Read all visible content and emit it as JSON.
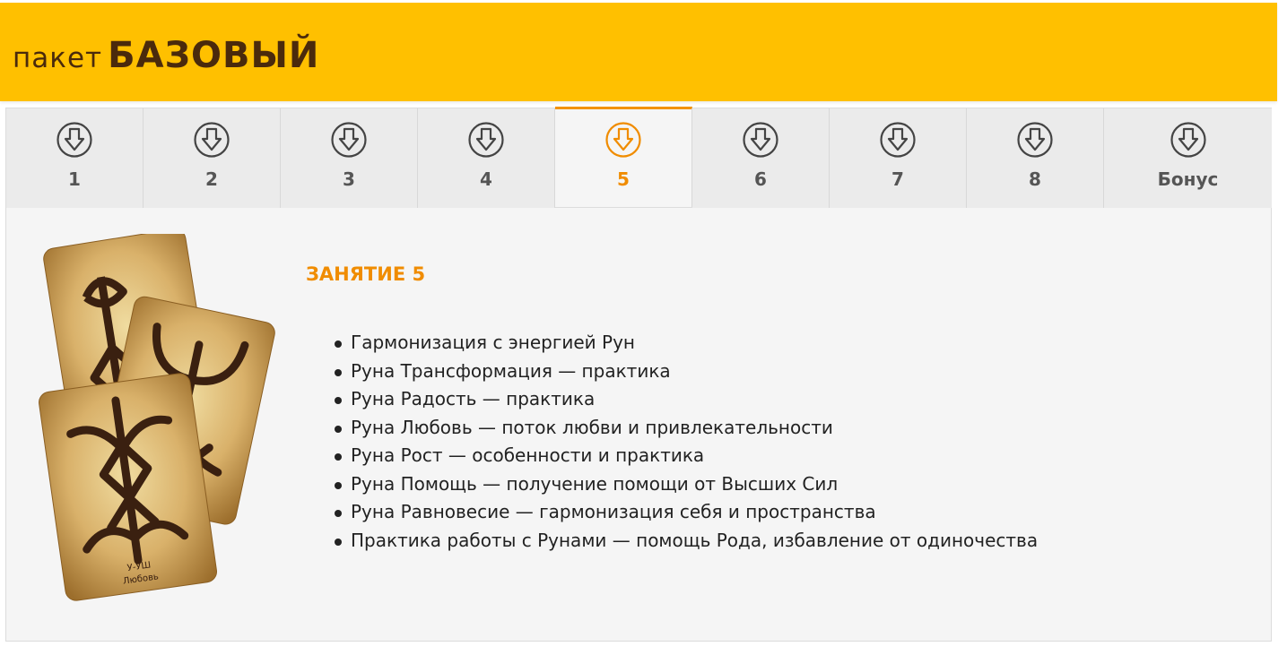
{
  "banner": {
    "title_small": "ПАКЕТ",
    "title_big": "БАЗОВЫЙ"
  },
  "tabs": [
    {
      "label": "1",
      "active": false
    },
    {
      "label": "2",
      "active": false
    },
    {
      "label": "3",
      "active": false
    },
    {
      "label": "4",
      "active": false
    },
    {
      "label": "5",
      "active": true
    },
    {
      "label": "6",
      "active": false
    },
    {
      "label": "7",
      "active": false
    },
    {
      "label": "8",
      "active": false
    },
    {
      "label": "Бонус",
      "active": false
    }
  ],
  "tab_icon": "download-circle-icon",
  "lesson": {
    "title": "ЗАНЯТИЕ 5",
    "topics": [
      "Гармонизация с энергией Рун",
      "Руна Трансформация — практика",
      "Руна Радость — практика",
      "Руна Любовь — поток любви и привлекательности",
      "Руна Рост — особенности и практика",
      "Руна Помощь — получение помощи от Высших Сил",
      "Руна Равновесие — гармонизация себя и пространства",
      "Практика работы с Рунами — помощь Рода, избавление от одиночества"
    ]
  },
  "cards_image": {
    "rune_name": "У-УШ",
    "rune_meaning": "Любовь"
  },
  "colors": {
    "banner": "#ffc000",
    "banner_text": "#4a2a0c",
    "accent": "#f08c00",
    "tab_bg": "#ebebeb",
    "panel_bg": "#f5f5f5",
    "text": "#222222"
  }
}
